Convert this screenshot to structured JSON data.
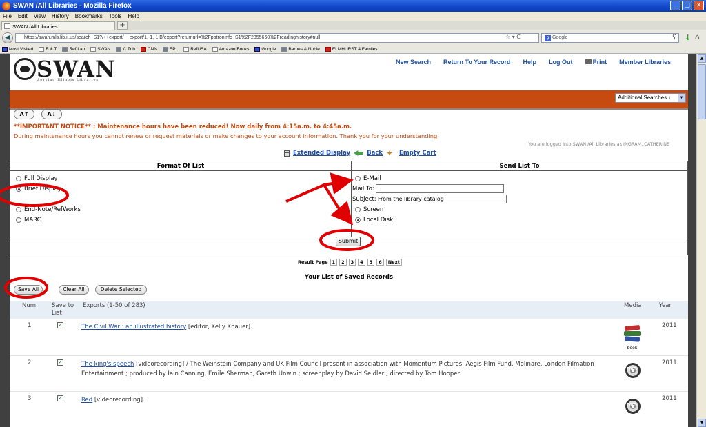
{
  "window": {
    "title": "SWAN /All Libraries - Mozilla Firefox"
  },
  "menu": [
    "File",
    "Edit",
    "View",
    "History",
    "Bookmarks",
    "Tools",
    "Help"
  ],
  "tab": {
    "label": "SWAN /All Libraries",
    "new_tab": "+"
  },
  "nav": {
    "url": "https://swan.mls.lib.il.us/search~S1?/++export/++export/1,-1,-1,B/export?returnurl=%2Fpatroninfo~S1%2F2355660%2Freadinghistory#null",
    "search_placeholder": "Google"
  },
  "bookmarks": [
    "Most Visited",
    "B & T",
    "Ref Lan",
    "SWAN",
    "C Trib",
    "CNN",
    "EPL",
    "RefUSA",
    "Amazon/Books",
    "Google",
    "Barnes & Noble",
    "ELMHURST 4 Familes"
  ],
  "site": {
    "logo": "SWAN",
    "tagline": "Serving Illinois Libraries",
    "topnav": [
      "New Search",
      "Return To Your Record",
      "Help",
      "Log Out",
      "Print",
      "Member Libraries"
    ],
    "additional_searches": "Additional Searches ↓",
    "font_up": "A↑",
    "font_down": "A↓",
    "notice_bold": "**IMPORTANT NOTICE** : Maintenance hours have been reduced! Now daily from 4:15a.m. to 4:45a.m.",
    "notice_text": "During maintenance hours you cannot renew or request materials or make changes to your account information. Thank you for your understanding.",
    "logged_in": "You are logged into SWAN /All Libraries as INGRAM, CATHERINE",
    "links": {
      "extended": "Extended Display",
      "back": "Back",
      "empty_cart": "Empty Cart"
    }
  },
  "export_form": {
    "format_heading": "Format Of List",
    "send_heading": "Send List To",
    "formats": [
      "Full Display",
      "Brief Display",
      "End-Note/RefWorks",
      "MARC"
    ],
    "selected_format": "Brief Display",
    "destinations": {
      "email": "E-Mail",
      "screen": "Screen",
      "local_disk": "Local Disk"
    },
    "mail_to_label": "Mail To:",
    "mail_to_value": "",
    "subject_label": "Subject:",
    "subject_value": "From the library catalog",
    "submit": "Submit"
  },
  "pager": {
    "label": "Result Page",
    "pages": [
      "1",
      "2",
      "3",
      "4",
      "5",
      "6"
    ],
    "next": "Next"
  },
  "list": {
    "title": "Your List of Saved Records",
    "buttons": {
      "save_all": "Save All",
      "clear_all": "Clear All",
      "delete_selected": "Delete Selected"
    },
    "headers": {
      "num": "Num",
      "save_to": "Save to",
      "list": "List",
      "exports": "Exports (1-50 of 283)",
      "media": "Media",
      "year": "Year"
    },
    "rows": [
      {
        "num": "1",
        "title": "The Civil War : an illustrated history",
        "rest": " [editor, Kelly Knauer].",
        "media": "book",
        "year": "2011"
      },
      {
        "num": "2",
        "title": "The king's speech",
        "rest": " [videorecording] / The Weinstein Company and UK Film Council present in association with Momentum Pictures, Aegis Film Fund, Molinare, London Filmation Entertainment ; produced by Iain Canning, Emile Sherman, Gareth Unwin ; screenplay by David Seidler ; directed by Tom Hooper.",
        "media": "DVD",
        "year": "2011"
      },
      {
        "num": "3",
        "title": "Red",
        "rest": " [videorecording].",
        "media": "DVD",
        "year": "2011"
      }
    ]
  },
  "colors": {
    "accent_orange": "#c74a10",
    "link_blue": "#1f4fa8",
    "annotation_red": "#e00000"
  }
}
